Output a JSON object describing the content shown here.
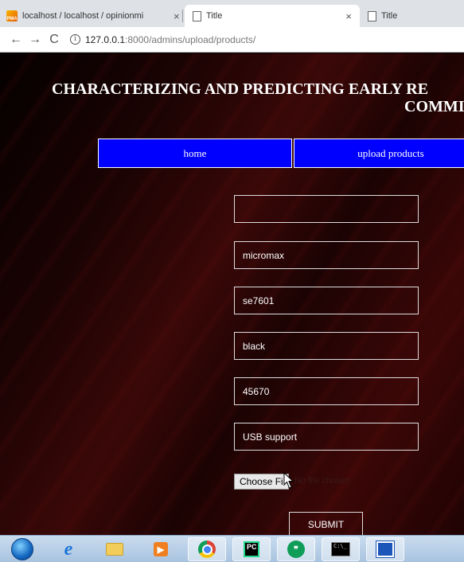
{
  "browser": {
    "tabs": [
      {
        "title": "localhost / localhost / opinionmi",
        "favicon": "phpmyadmin-icon"
      },
      {
        "title": "Title",
        "favicon": "document-icon"
      },
      {
        "title": "Title",
        "favicon": "document-icon"
      }
    ],
    "close_glyph": "×",
    "nav": {
      "back": "←",
      "forward": "→",
      "reload": "C"
    },
    "url": {
      "host": "127.0.0.1",
      "path": ":8000/admins/upload/products/"
    }
  },
  "page": {
    "heading_line1": "CHARACTERIZING AND PREDICTING EARLY RE",
    "heading_line2": "COMMI",
    "nav": {
      "home": "home",
      "upload": "upload products"
    },
    "form": {
      "field1": "",
      "field2": "micromax",
      "field3": "se7601",
      "field4": "black",
      "field5": "45670",
      "field6": "USB support",
      "file_button": "Choose Fi",
      "file_status": "No file chosen",
      "submit": "SUBMIT"
    }
  },
  "taskbar": {
    "items": [
      "start-orb-icon",
      "internet-explorer-icon",
      "file-explorer-icon",
      "media-player-icon",
      "chrome-icon",
      "pycharm-icon",
      "hangouts-icon",
      "command-prompt-icon",
      "remote-desktop-icon"
    ],
    "pycharm_text": "PC",
    "cmd_text": "C:\\_"
  }
}
